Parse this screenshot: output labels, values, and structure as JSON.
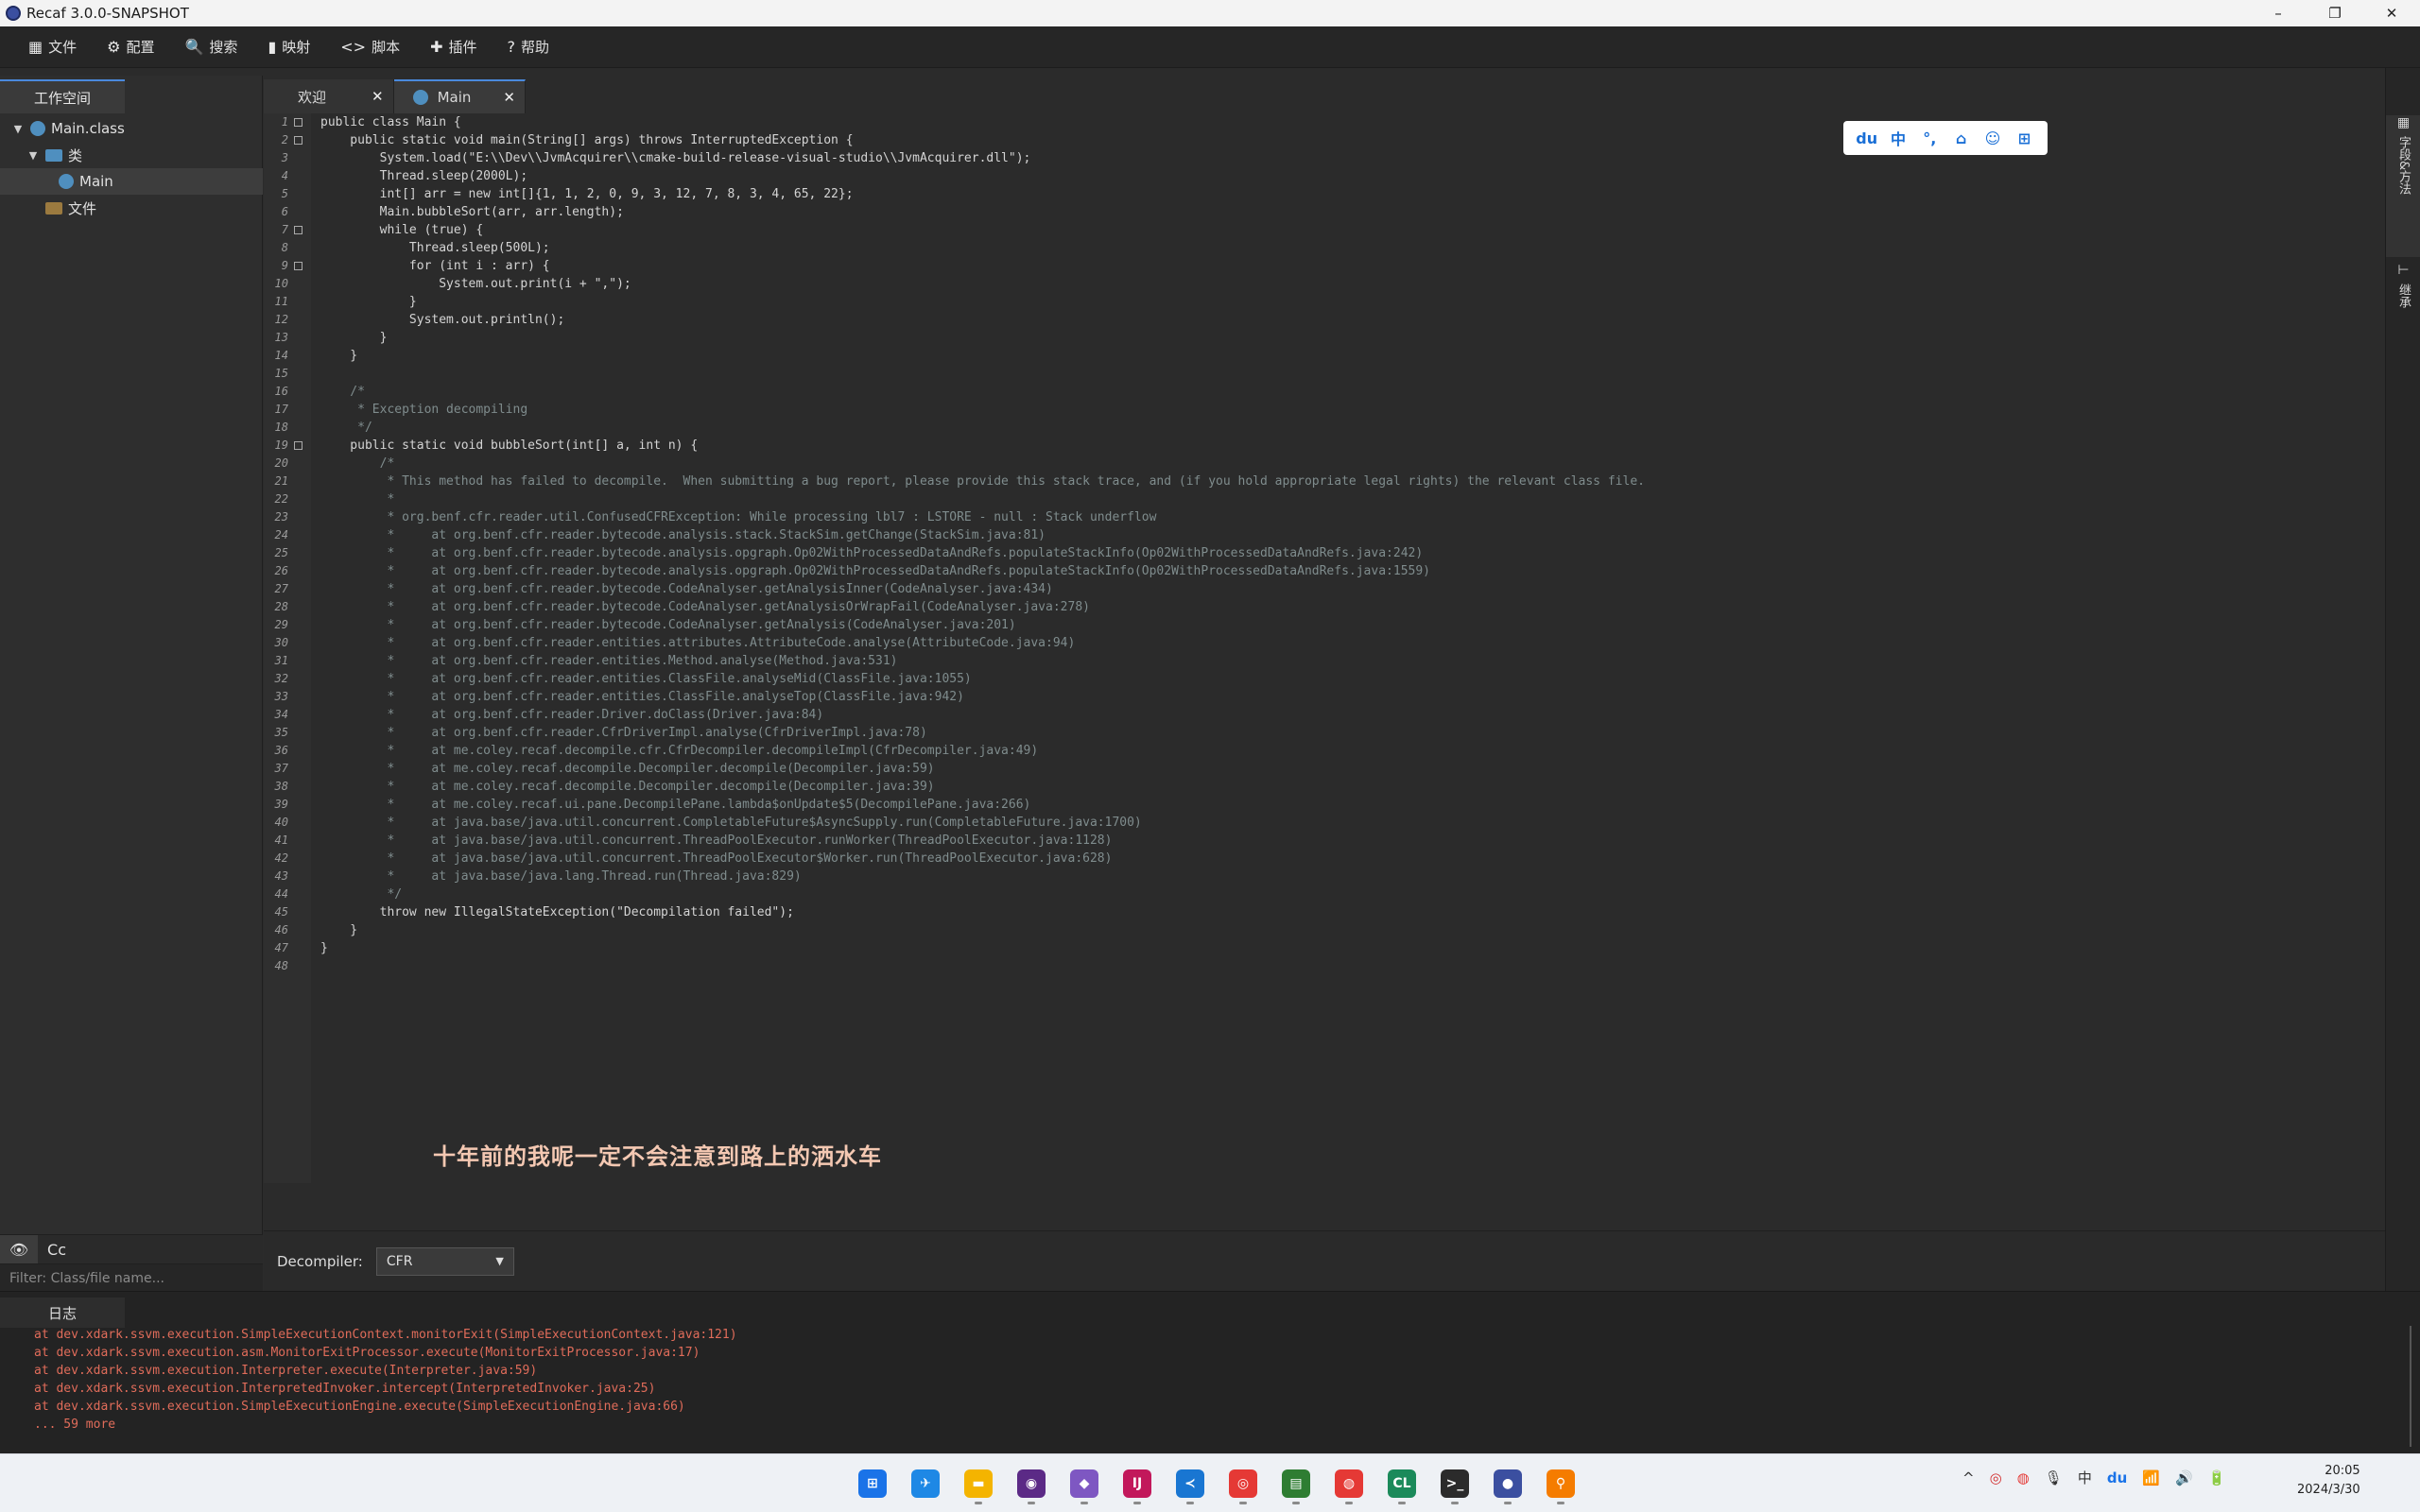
{
  "window": {
    "title": "Recaf 3.0.0-SNAPSHOT",
    "minimize": "–",
    "maximize": "❐",
    "close": "✕"
  },
  "menu": [
    {
      "icon": "grid-icon",
      "glyph": "▦",
      "label": "文件"
    },
    {
      "icon": "gear-icon",
      "glyph": "⚙",
      "label": "配置"
    },
    {
      "icon": "search-icon",
      "glyph": "🔍",
      "label": "搜索"
    },
    {
      "icon": "mapping-icon",
      "glyph": "▮",
      "label": "映射"
    },
    {
      "icon": "code-icon",
      "glyph": "<>",
      "label": "脚本"
    },
    {
      "icon": "puzzle-icon",
      "glyph": "✚",
      "label": "插件"
    },
    {
      "icon": "help-icon",
      "glyph": "?",
      "label": "帮助"
    }
  ],
  "workspace": {
    "tab": "工作空间",
    "tree": {
      "root": "Main.class",
      "classes": "类",
      "main": "Main",
      "files": "文件"
    },
    "toggle_eye": "👁",
    "toggle_case": "Cc",
    "filter_placeholder": "Filter: Class/file name..."
  },
  "editor": {
    "tabs": [
      {
        "label": "欢迎",
        "close": "✕"
      },
      {
        "label": "Main",
        "close": "✕"
      }
    ],
    "code_lines": [
      "public class Main {",
      "    public static void main(String[] args) throws InterruptedException {",
      "        System.load(\"E:\\\\Dev\\\\JvmAcquirer\\\\cmake-build-release-visual-studio\\\\JvmAcquirer.dll\");",
      "        Thread.sleep(2000L);",
      "        int[] arr = new int[]{1, 1, 2, 0, 9, 3, 12, 7, 8, 3, 4, 65, 22};",
      "        Main.bubbleSort(arr, arr.length);",
      "        while (true) {",
      "            Thread.sleep(500L);",
      "            for (int i : arr) {",
      "                System.out.print(i + \",\");",
      "            }",
      "            System.out.println();",
      "        }",
      "    }",
      "",
      "    /*",
      "     * Exception decompiling",
      "     */",
      "    public static void bubbleSort(int[] a, int n) {",
      "        /*",
      "         * This method has failed to decompile.  When submitting a bug report, please provide this stack trace, and (if you hold appropriate legal rights) the relevant class file.",
      "         *",
      "         * org.benf.cfr.reader.util.ConfusedCFRException: While processing lbl7 : LSTORE - null : Stack underflow",
      "         *     at org.benf.cfr.reader.bytecode.analysis.stack.StackSim.getChange(StackSim.java:81)",
      "         *     at org.benf.cfr.reader.bytecode.analysis.opgraph.Op02WithProcessedDataAndRefs.populateStackInfo(Op02WithProcessedDataAndRefs.java:242)",
      "         *     at org.benf.cfr.reader.bytecode.analysis.opgraph.Op02WithProcessedDataAndRefs.populateStackInfo(Op02WithProcessedDataAndRefs.java:1559)",
      "         *     at org.benf.cfr.reader.bytecode.CodeAnalyser.getAnalysisInner(CodeAnalyser.java:434)",
      "         *     at org.benf.cfr.reader.bytecode.CodeAnalyser.getAnalysisOrWrapFail(CodeAnalyser.java:278)",
      "         *     at org.benf.cfr.reader.bytecode.CodeAnalyser.getAnalysis(CodeAnalyser.java:201)",
      "         *     at org.benf.cfr.reader.entities.attributes.AttributeCode.analyse(AttributeCode.java:94)",
      "         *     at org.benf.cfr.reader.entities.Method.analyse(Method.java:531)",
      "         *     at org.benf.cfr.reader.entities.ClassFile.analyseMid(ClassFile.java:1055)",
      "         *     at org.benf.cfr.reader.entities.ClassFile.analyseTop(ClassFile.java:942)",
      "         *     at org.benf.cfr.reader.Driver.doClass(Driver.java:84)",
      "         *     at org.benf.cfr.reader.CfrDriverImpl.analyse(CfrDriverImpl.java:78)",
      "         *     at me.coley.recaf.decompile.cfr.CfrDecompiler.decompileImpl(CfrDecompiler.java:49)",
      "         *     at me.coley.recaf.decompile.Decompiler.decompile(Decompiler.java:59)",
      "         *     at me.coley.recaf.decompile.Decompiler.decompile(Decompiler.java:39)",
      "         *     at me.coley.recaf.ui.pane.DecompilePane.lambda$onUpdate$5(DecompilePane.java:266)",
      "         *     at java.base/java.util.concurrent.CompletableFuture$AsyncSupply.run(CompletableFuture.java:1700)",
      "         *     at java.base/java.util.concurrent.ThreadPoolExecutor.runWorker(ThreadPoolExecutor.java:1128)",
      "         *     at java.base/java.util.concurrent.ThreadPoolExecutor$Worker.run(ThreadPoolExecutor.java:628)",
      "         *     at java.base/java.lang.Thread.run(Thread.java:829)",
      "         */",
      "        throw new IllegalStateException(\"Decompilation failed\");",
      "    }",
      "}",
      ""
    ]
  },
  "ime_toolbar": [
    "du",
    "中",
    "°,",
    "⌂",
    "☺",
    "⊞"
  ],
  "subtitle": "十年前的我呢一定不会注意到路上的洒水车",
  "decompiler": {
    "label": "Decompiler:",
    "value": "CFR"
  },
  "right_dock": {
    "fields_methods": "字段&方法",
    "inheritance": "继承"
  },
  "log": {
    "tab": "日志",
    "lines": [
      "at dev.xdark.ssvm.execution.SimpleExecutionContext.monitorExit(SimpleExecutionContext.java:121)",
      "at dev.xdark.ssvm.execution.asm.MonitorExitProcessor.execute(MonitorExitProcessor.java:17)",
      "at dev.xdark.ssvm.execution.Interpreter.execute(Interpreter.java:59)",
      "at dev.xdark.ssvm.execution.InterpretedInvoker.intercept(InterpretedInvoker.java:25)",
      "at dev.xdark.ssvm.execution.SimpleExecutionEngine.execute(SimpleExecutionEngine.java:66)",
      "... 59 more"
    ]
  },
  "taskbar": {
    "apps": [
      {
        "name": "start-icon",
        "glyph": "⊞",
        "color": "#1a73e8"
      },
      {
        "name": "app-blue-icon",
        "glyph": "✈",
        "color": "#1e88e5"
      },
      {
        "name": "file-explorer-icon",
        "glyph": "▬",
        "color": "#f4b400"
      },
      {
        "name": "gog-icon",
        "glyph": "◉",
        "color": "#5b2a86"
      },
      {
        "name": "visual-studio-icon",
        "glyph": "◆",
        "color": "#7e57c2"
      },
      {
        "name": "intellij-icon",
        "glyph": "IJ",
        "color": "#c2185b"
      },
      {
        "name": "vscode-icon",
        "glyph": "≺",
        "color": "#1976d2"
      },
      {
        "name": "chrome-icon",
        "glyph": "◎",
        "color": "#e53935"
      },
      {
        "name": "terminal-green-icon",
        "glyph": "▤",
        "color": "#2e7d32"
      },
      {
        "name": "netease-music-icon",
        "glyph": "◍",
        "color": "#e53935"
      },
      {
        "name": "clion-icon",
        "glyph": "CL",
        "color": "#1b8a5a"
      },
      {
        "name": "terminal-icon",
        "glyph": ">_",
        "color": "#2b2b2b"
      },
      {
        "name": "recaf-icon",
        "glyph": "●",
        "color": "#3b4fa0"
      },
      {
        "name": "search-tool-icon",
        "glyph": "⚲",
        "color": "#f57c00"
      }
    ],
    "tray": [
      "^",
      "◎",
      "◍",
      "🎙",
      "中",
      "du",
      "📶",
      "🔊",
      "🔋"
    ],
    "time": "20:05",
    "date": "2024/3/30"
  }
}
